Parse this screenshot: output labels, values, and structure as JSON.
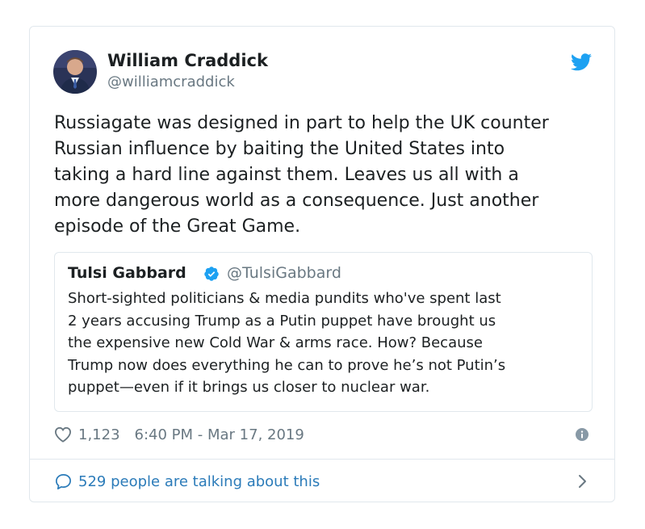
{
  "tweet": {
    "author": {
      "name": "William Craddick",
      "handle": "@williamcraddick"
    },
    "text": "Russiagate was designed in part to help the UK counter\nRussian influence by baiting the United States into\ntaking a hard line against them. Leaves us all with a\nmore dangerous world as a consequence. Just another\nepisode of the Great Game.",
    "quoted": {
      "name": "Tulsi Gabbard",
      "handle": "@TulsiGabbard",
      "text": "Short-sighted politicians & media pundits who've spent last\n2 years accusing Trump as a Putin puppet have brought us\nthe expensive new Cold War & arms race. How? Because\nTrump now does everything he can to prove he’s not Putin’s\npuppet—even if it brings us closer to nuclear war."
    },
    "likes": "1,123",
    "timestamp": "6:40 PM - Mar 17, 2019",
    "conversation_label": "529 people are talking about this"
  },
  "icons": {
    "brand": "twitter-bird-icon",
    "like": "heart-icon",
    "info": "info-icon",
    "reply": "speech-bubble-icon",
    "more": "chevron-right-icon",
    "verified": "verified-badge-icon"
  },
  "colors": {
    "twitter_blue": "#1da1f2",
    "link_blue": "#2b7bb9",
    "secondary_text": "#697882",
    "border": "#e1e8ed"
  }
}
